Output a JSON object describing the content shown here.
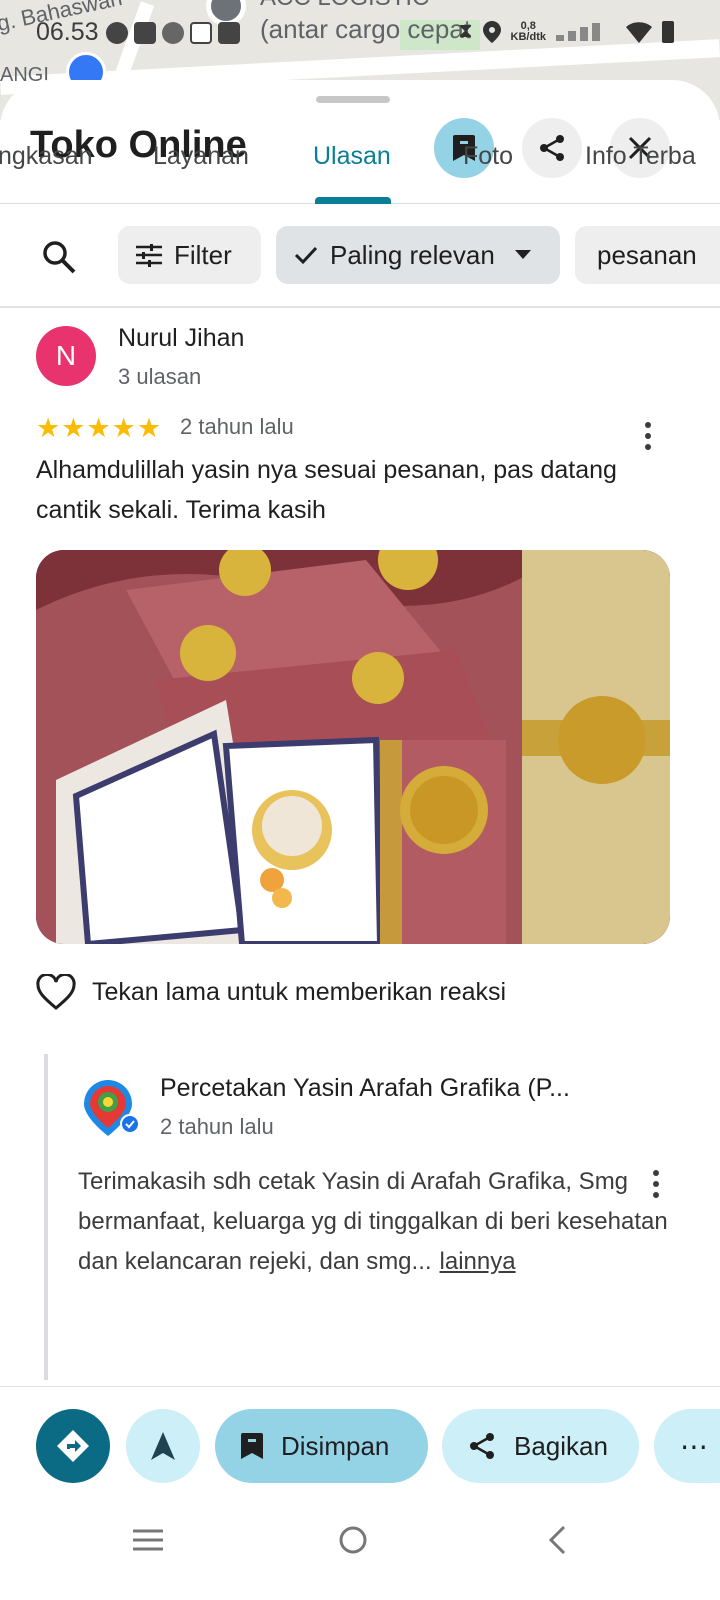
{
  "status_bar": {
    "time": "06.53",
    "net_speed_value": "0,8",
    "net_speed_unit": "KB/dtk"
  },
  "map": {
    "label_top": "g. Bahaswan",
    "label_acc": "ACC LOGISTIC",
    "label_cargo": "(antar cargo cepat",
    "label_left": "ANGI"
  },
  "header": {
    "title": "Toko Online"
  },
  "tabs": [
    {
      "label": "ngkasan"
    },
    {
      "label": "Layanan"
    },
    {
      "label": "Ulasan"
    },
    {
      "label": "Foto"
    },
    {
      "label": "Info Terba"
    }
  ],
  "filters": {
    "filter_label": "Filter",
    "sort_label": "Paling relevan",
    "keyword_label": "pesanan"
  },
  "review": {
    "avatar_letter": "N",
    "name": "Nurul Jihan",
    "count": "3 ulasan",
    "rating": 5,
    "time": "2 tahun lalu",
    "text": "Alhamdulillah yasin nya sesuai pesanan, pas datang cantik sekali. Terima kasih",
    "reaction_hint": "Tekan lama untuk memberikan reaksi"
  },
  "owner_response": {
    "name": "Percetakan Yasin Arafah Grafika (P...",
    "time": "2 tahun lalu",
    "text": "Terimakasih sdh cetak Yasin di Arafah Grafika, Smg bermanfaat, keluarga yg di tinggalkan di beri kesehatan dan kelancaran rejeki, dan smg...",
    "more_label": "lainnya"
  },
  "actions": {
    "saved_label": "Disimpan",
    "share_label": "Bagikan"
  },
  "colors": {
    "accent": "#0b7d97",
    "saved_bg": "#94d3e6",
    "light_bg": "#cdeff7",
    "avatar": "#e8336e",
    "star": "#fbbc04"
  }
}
